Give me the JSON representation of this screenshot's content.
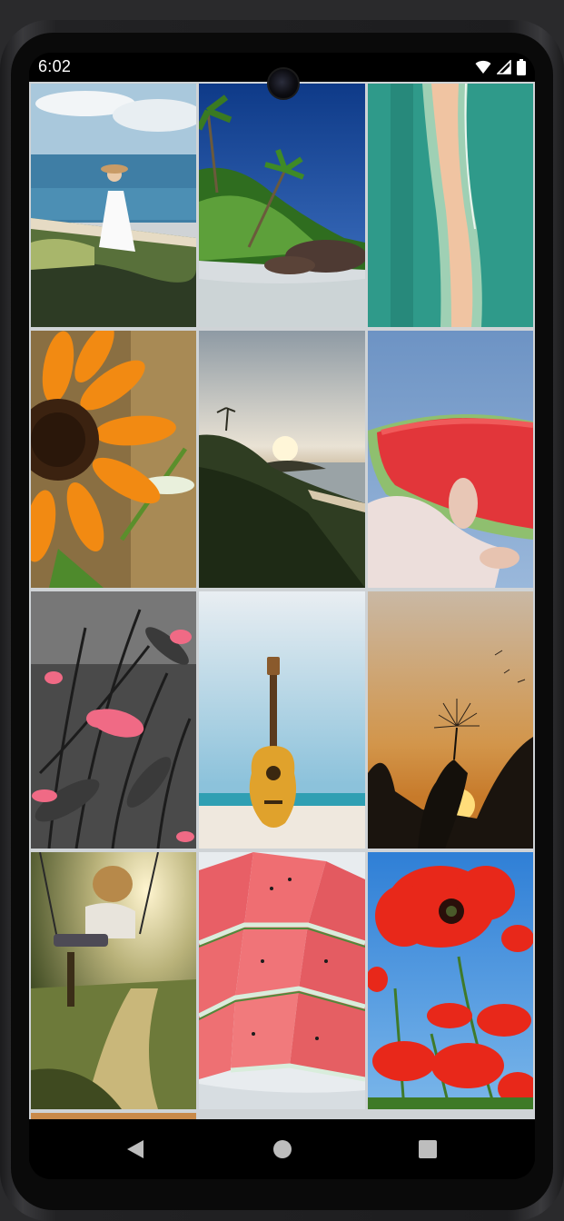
{
  "status_bar": {
    "time": "6:02",
    "icons": [
      "wifi-icon",
      "cellular-signal-icon",
      "battery-icon"
    ]
  },
  "gallery": {
    "photos": [
      {
        "name": "photo-woman-sea-painting"
      },
      {
        "name": "photo-tropical-beach-palms"
      },
      {
        "name": "photo-aerial-sandbar"
      },
      {
        "name": "photo-sunflower"
      },
      {
        "name": "photo-coastal-sunset"
      },
      {
        "name": "photo-watermelon-slice-hand"
      },
      {
        "name": "photo-pink-flowers"
      },
      {
        "name": "photo-guitar-beach"
      },
      {
        "name": "photo-dandelion-sunset"
      },
      {
        "name": "photo-child-swing"
      },
      {
        "name": "photo-watermelon-plate"
      },
      {
        "name": "photo-red-poppies"
      }
    ]
  },
  "nav_bar": {
    "buttons": [
      "back-icon",
      "home-icon",
      "recents-icon"
    ]
  },
  "colors": {
    "background": "#000000",
    "grid_divider": "#cfd3d6",
    "status_text": "#ffffff"
  }
}
